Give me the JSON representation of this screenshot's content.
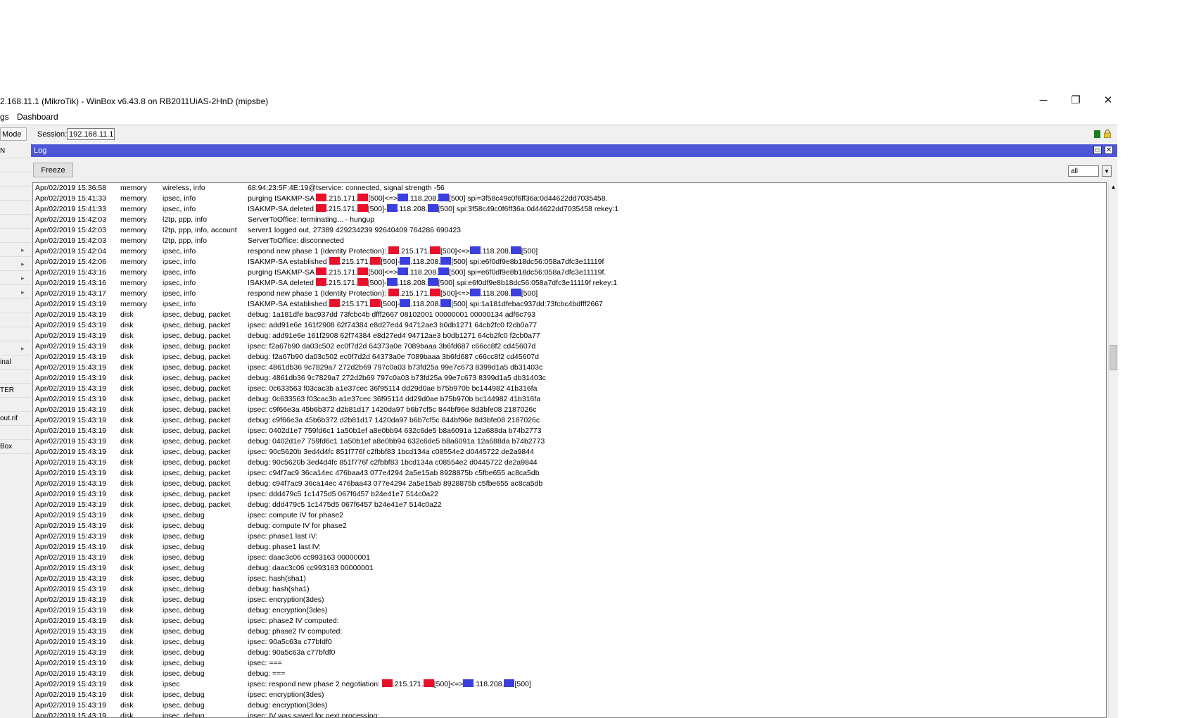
{
  "window": {
    "title": "2.168.11.1 (MikroTik) - WinBox v6.43.8 on RB2011UiAS-2HnD (mipsbe)",
    "minimize": "─",
    "restore": "❐",
    "close": "✕"
  },
  "menu": {
    "items": [
      "gs",
      "Dashboard"
    ]
  },
  "toolbar": {
    "mode_label": "Mode",
    "session_label": "Session:",
    "session_value": "192.168.11.1"
  },
  "sidebar": {
    "items": [
      {
        "label": "N"
      },
      {
        "label": ""
      },
      {
        "label": ""
      },
      {
        "label": ""
      },
      {
        "label": ""
      },
      {
        "label": ""
      },
      {
        "label": ""
      },
      {
        "label": ""
      },
      {
        "label": ""
      },
      {
        "label": ""
      },
      {
        "label": ""
      },
      {
        "label": ""
      },
      {
        "label": ""
      },
      {
        "label": ""
      },
      {
        "label": ""
      },
      {
        "label": "inal"
      },
      {
        "label": ""
      },
      {
        "label": "TER"
      },
      {
        "label": ""
      },
      {
        "label": "out.rif"
      },
      {
        "label": ""
      },
      {
        "label": "Box"
      }
    ]
  },
  "log": {
    "title": "Log",
    "freeze_label": "Freeze",
    "filter_value": "all",
    "rows": [
      {
        "time": "Apr/02/2019 15:36:58",
        "buffer": "memory",
        "topics": "wireless, info",
        "message": "68:94:23:5F:4E:19@tservice: connected, signal strength -56"
      },
      {
        "time": "Apr/02/2019 15:41:33",
        "buffer": "memory",
        "topics": "ipsec, info",
        "message": "purging ISAKMP-SA ▇.215.171.▇[500]<=>▇.118.208.▇[500] spi=3f58c49c0f6ff36a:0d44622dd7035458."
      },
      {
        "time": "Apr/02/2019 15:41:33",
        "buffer": "memory",
        "topics": "ipsec, info",
        "message": "ISAKMP-SA deleted ▇.215.171.▇[500]-▇.118.208.▇[500] spi:3f58c49c0f6ff36a:0d44622dd7035458 rekey:1"
      },
      {
        "time": "Apr/02/2019 15:42:03",
        "buffer": "memory",
        "topics": "l2tp, ppp, info",
        "message": "ServerToOffice: terminating... - hungup"
      },
      {
        "time": "Apr/02/2019 15:42:03",
        "buffer": "memory",
        "topics": "l2tp, ppp, info, account",
        "message": "server1 logged out, 27389 429234239 92640409 764286 690423"
      },
      {
        "time": "Apr/02/2019 15:42:03",
        "buffer": "memory",
        "topics": "l2tp, ppp, info",
        "message": "ServerToOffice: disconnected"
      },
      {
        "time": "Apr/02/2019 15:42:04",
        "buffer": "memory",
        "topics": "ipsec, info",
        "message": "respond new phase 1 (Identity Protection): ▇.215.171.▇[500]<=>▇.118.208.▇[500]"
      },
      {
        "time": "Apr/02/2019 15:42:06",
        "buffer": "memory",
        "topics": "ipsec, info",
        "message": "ISAKMP-SA established ▇.215.171.▇[500]-▇.118.208.▇[500] spi:e6f0df9e8b18dc56:058a7dfc3e11119f"
      },
      {
        "time": "Apr/02/2019 15:43:16",
        "buffer": "memory",
        "topics": "ipsec, info",
        "message": "purging ISAKMP-SA ▇.215.171.▇[500]<=>▇.118.208.▇[500] spi=e6f0df9e8b18dc56:058a7dfc3e11119f."
      },
      {
        "time": "Apr/02/2019 15:43:16",
        "buffer": "memory",
        "topics": "ipsec, info",
        "message": "ISAKMP-SA deleted ▇.215.171.▇[500]-▇.118.208.▇[500] spi:e6f0df9e8b18dc56:058a7dfc3e11119f rekey:1"
      },
      {
        "time": "Apr/02/2019 15:43:17",
        "buffer": "memory",
        "topics": "ipsec, info",
        "message": "respond new phase 1 (Identity Protection): ▇.215.171.▇[500]<=>▇.118.208.▇[500]"
      },
      {
        "time": "Apr/02/2019 15:43:19",
        "buffer": "memory",
        "topics": "ipsec, info",
        "message": "ISAKMP-SA established ▇.215.171.▇[500]-▇.118.208.▇[500] spi:1a181dfebac937dd:73fcbc4bdfff2667"
      },
      {
        "time": "Apr/02/2019 15:43:19",
        "buffer": "disk",
        "topics": "ipsec, debug, packet",
        "message": "debug: 1a181dfe bac937dd 73fcbc4b dfff2667 08102001 00000001 00000134 adf6c793"
      },
      {
        "time": "Apr/02/2019 15:43:19",
        "buffer": "disk",
        "topics": "ipsec, debug, packet",
        "message": "ipsec: add91e6e 161f2908 62f74384 e8d27ed4 94712ae3 b0db1271 64cb2fc0 f2cb0a77"
      },
      {
        "time": "Apr/02/2019 15:43:19",
        "buffer": "disk",
        "topics": "ipsec, debug, packet",
        "message": "debug: add91e6e 161f2908 62f74384 e8d27ed4 94712ae3 b0db1271 64cb2fc0 f2cb0a77"
      },
      {
        "time": "Apr/02/2019 15:43:19",
        "buffer": "disk",
        "topics": "ipsec, debug, packet",
        "message": "ipsec: f2a67b90 da03c502 ec0f7d2d 64373a0e 7089baaa 3b6fd687 c66cc8f2 cd45607d"
      },
      {
        "time": "Apr/02/2019 15:43:19",
        "buffer": "disk",
        "topics": "ipsec, debug, packet",
        "message": "debug: f2a67b90 da03c502 ec0f7d2d 64373a0e 7089baaa 3b6fd687 c66cc8f2 cd45607d"
      },
      {
        "time": "Apr/02/2019 15:43:19",
        "buffer": "disk",
        "topics": "ipsec, debug, packet",
        "message": "ipsec: 4861db36 9c7829a7 272d2b69 797c0a03 b73fd25a 99e7c673 8399d1a5 db31403c"
      },
      {
        "time": "Apr/02/2019 15:43:19",
        "buffer": "disk",
        "topics": "ipsec, debug, packet",
        "message": "debug: 4861db36 9c7829a7 272d2b69 797c0a03 b73fd25a 99e7c673 8399d1a5 db31403c"
      },
      {
        "time": "Apr/02/2019 15:43:19",
        "buffer": "disk",
        "topics": "ipsec, debug, packet",
        "message": "ipsec: 0c633563 f03cac3b a1e37cec 36f95114 dd29d0ae b75b970b bc144982 41b316fa"
      },
      {
        "time": "Apr/02/2019 15:43:19",
        "buffer": "disk",
        "topics": "ipsec, debug, packet",
        "message": "debug: 0c633563 f03cac3b a1e37cec 36f95114 dd29d0ae b75b970b bc144982 41b316fa"
      },
      {
        "time": "Apr/02/2019 15:43:19",
        "buffer": "disk",
        "topics": "ipsec, debug, packet",
        "message": "ipsec: c9f66e3a 45b6b372 d2b81d17 1420da97 b6b7cf5c 844bf96e 8d3bfe08 2187026c"
      },
      {
        "time": "Apr/02/2019 15:43:19",
        "buffer": "disk",
        "topics": "ipsec, debug, packet",
        "message": "debug: c9f66e3a 45b6b372 d2b81d17 1420da97 b6b7cf5c 844bf96e 8d3bfe08 2187026c"
      },
      {
        "time": "Apr/02/2019 15:43:19",
        "buffer": "disk",
        "topics": "ipsec, debug, packet",
        "message": "ipsec: 0402d1e7 759fd6c1 1a50b1ef a8e0bb94 632c6de5 b8a6091a 12a688da b74b2773"
      },
      {
        "time": "Apr/02/2019 15:43:19",
        "buffer": "disk",
        "topics": "ipsec, debug, packet",
        "message": "debug: 0402d1e7 759fd6c1 1a50b1ef a8e0bb94 632c6de5 b8a6091a 12a688da b74b2773"
      },
      {
        "time": "Apr/02/2019 15:43:19",
        "buffer": "disk",
        "topics": "ipsec, debug, packet",
        "message": "ipsec: 90c5620b 3ed4d4fc 851f776f c2fbbf83 1bcd134a c08554e2 d0445722 de2a9844"
      },
      {
        "time": "Apr/02/2019 15:43:19",
        "buffer": "disk",
        "topics": "ipsec, debug, packet",
        "message": "debug: 90c5620b 3ed4d4fc 851f776f c2fbbf83 1bcd134a c08554e2 d0445722 de2a9844"
      },
      {
        "time": "Apr/02/2019 15:43:19",
        "buffer": "disk",
        "topics": "ipsec, debug, packet",
        "message": "ipsec: c94f7ac9 36ca14ec 476baa43 077e4294 2a5e15ab 8928875b c5fbe655 ac8ca5db"
      },
      {
        "time": "Apr/02/2019 15:43:19",
        "buffer": "disk",
        "topics": "ipsec, debug, packet",
        "message": "debug: c94f7ac9 36ca14ec 476baa43 077e4294 2a5e15ab 8928875b c5fbe655 ac8ca5db"
      },
      {
        "time": "Apr/02/2019 15:43:19",
        "buffer": "disk",
        "topics": "ipsec, debug, packet",
        "message": "ipsec: ddd479c5 1c1475d5 067f6457 b24e41e7 514c0a22"
      },
      {
        "time": "Apr/02/2019 15:43:19",
        "buffer": "disk",
        "topics": "ipsec, debug, packet",
        "message": "debug: ddd479c5 1c1475d5 067f6457 b24e41e7 514c0a22"
      },
      {
        "time": "Apr/02/2019 15:43:19",
        "buffer": "disk",
        "topics": "ipsec, debug",
        "message": "ipsec: compute IV for phase2"
      },
      {
        "time": "Apr/02/2019 15:43:19",
        "buffer": "disk",
        "topics": "ipsec, debug",
        "message": "debug: compute IV for phase2"
      },
      {
        "time": "Apr/02/2019 15:43:19",
        "buffer": "disk",
        "topics": "ipsec, debug",
        "message": "ipsec: phase1 last IV:"
      },
      {
        "time": "Apr/02/2019 15:43:19",
        "buffer": "disk",
        "topics": "ipsec, debug",
        "message": "debug: phase1 last IV:"
      },
      {
        "time": "Apr/02/2019 15:43:19",
        "buffer": "disk",
        "topics": "ipsec, debug",
        "message": "ipsec: daac3c06 cc993163 00000001"
      },
      {
        "time": "Apr/02/2019 15:43:19",
        "buffer": "disk",
        "topics": "ipsec, debug",
        "message": "debug: daac3c06 cc993163 00000001"
      },
      {
        "time": "Apr/02/2019 15:43:19",
        "buffer": "disk",
        "topics": "ipsec, debug",
        "message": "ipsec: hash(sha1)"
      },
      {
        "time": "Apr/02/2019 15:43:19",
        "buffer": "disk",
        "topics": "ipsec, debug",
        "message": "debug: hash(sha1)"
      },
      {
        "time": "Apr/02/2019 15:43:19",
        "buffer": "disk",
        "topics": "ipsec, debug",
        "message": "ipsec: encryption(3des)"
      },
      {
        "time": "Apr/02/2019 15:43:19",
        "buffer": "disk",
        "topics": "ipsec, debug",
        "message": "debug: encryption(3des)"
      },
      {
        "time": "Apr/02/2019 15:43:19",
        "buffer": "disk",
        "topics": "ipsec, debug",
        "message": "ipsec: phase2 IV computed:"
      },
      {
        "time": "Apr/02/2019 15:43:19",
        "buffer": "disk",
        "topics": "ipsec, debug",
        "message": "debug: phase2 IV computed:"
      },
      {
        "time": "Apr/02/2019 15:43:19",
        "buffer": "disk",
        "topics": "ipsec, debug",
        "message": "ipsec: 90a5c63a c77bfdf0"
      },
      {
        "time": "Apr/02/2019 15:43:19",
        "buffer": "disk",
        "topics": "ipsec, debug",
        "message": "debug: 90a5c63a c77bfdf0"
      },
      {
        "time": "Apr/02/2019 15:43:19",
        "buffer": "disk",
        "topics": "ipsec, debug",
        "message": "ipsec: ==="
      },
      {
        "time": "Apr/02/2019 15:43:19",
        "buffer": "disk",
        "topics": "ipsec, debug",
        "message": "debug: ==="
      },
      {
        "time": "Apr/02/2019 15:43:19",
        "buffer": "disk",
        "topics": "ipsec",
        "message": "ipsec: respond new phase 2 negotiation: ▇.215.171.▇[500]<=>▇.118.208.▇[500]"
      },
      {
        "time": "Apr/02/2019 15:43:19",
        "buffer": "disk",
        "topics": "ipsec, debug",
        "message": "ipsec: encryption(3des)"
      },
      {
        "time": "Apr/02/2019 15:43:19",
        "buffer": "disk",
        "topics": "ipsec, debug",
        "message": "debug: encryption(3des)"
      },
      {
        "time": "Apr/02/2019 15:43:19",
        "buffer": "disk",
        "topics": "ipsec, debug",
        "message": "ipsec: IV was saved for next processing:"
      }
    ]
  },
  "colors": {
    "accent": "#4c56d6",
    "redact_red": "#e8102a",
    "redact_blue": "#3b3fe0"
  }
}
